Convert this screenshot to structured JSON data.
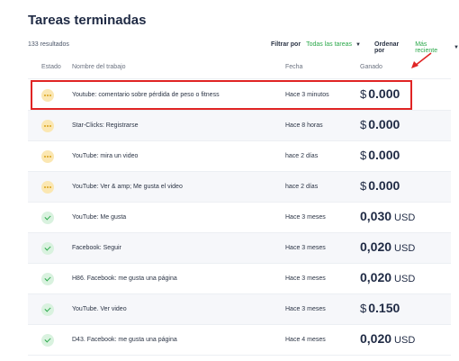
{
  "page": {
    "title": "Tareas terminadas",
    "count": "133 resultados"
  },
  "filters": {
    "filter_label": "Filtrar por",
    "filter_value": "Todas las tareas",
    "order_label": "Ordenar por",
    "order_value": "Más reciente"
  },
  "columns": {
    "status": "Estado",
    "name": "Nombre del trabajo",
    "date": "Fecha",
    "earned": "Ganado"
  },
  "rows": [
    {
      "status": "pending",
      "name": "Youtube: comentario sobre pérdida de peso o fitness",
      "date": "Hace 3 minutos",
      "currency": "$",
      "amount": "0.000",
      "unit": ""
    },
    {
      "status": "pending",
      "name": "Star-Clicks: Registrarse",
      "date": "Hace 8 horas",
      "currency": "$",
      "amount": "0.000",
      "unit": ""
    },
    {
      "status": "pending",
      "name": "YouTube: mira un video",
      "date": "hace 2 días",
      "currency": "$",
      "amount": "0.000",
      "unit": ""
    },
    {
      "status": "pending",
      "name": "YouTube: Ver & amp; Me gusta el video",
      "date": "hace 2 días",
      "currency": "$",
      "amount": "0.000",
      "unit": ""
    },
    {
      "status": "done",
      "name": "YouTube: Me gusta",
      "date": "Hace 3 meses",
      "currency": "",
      "amount": "0,030",
      "unit": "USD"
    },
    {
      "status": "done",
      "name": "Facebook: Seguir",
      "date": "Hace 3 meses",
      "currency": "",
      "amount": "0,020",
      "unit": "USD"
    },
    {
      "status": "done",
      "name": "H86. Facebook: me gusta una página",
      "date": "Hace 3 meses",
      "currency": "",
      "amount": "0,020",
      "unit": "USD"
    },
    {
      "status": "done",
      "name": "YouTube. Ver video",
      "date": "Hace 3 meses",
      "currency": "$",
      "amount": "0.150",
      "unit": ""
    },
    {
      "status": "done",
      "name": "D43. Facebook: me gusta una página",
      "date": "Hace 4 meses",
      "currency": "",
      "amount": "0,020",
      "unit": "USD"
    }
  ],
  "colors": {
    "accent_green": "#2aa84a",
    "pending_yellow": "#d9a21b",
    "highlight_red": "#e02424"
  },
  "icons": {
    "pending": "dots-icon",
    "done": "check-icon"
  }
}
